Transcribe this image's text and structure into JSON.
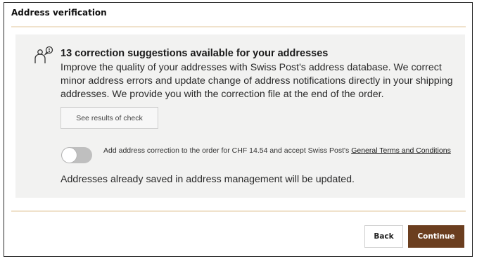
{
  "dialog": {
    "title": "Address verification"
  },
  "panel": {
    "icon": "address-correction-people-icon",
    "headline": "13 correction suggestions available for your addresses",
    "description": "Improve the quality of your addresses with Swiss Post's address database. We correct minor address errors and update change of address notifications directly in your shipping addresses. We provide you with the correction file at the end of the order.",
    "results_button_label": "See results of check",
    "toggle": {
      "state": "off",
      "label_prefix": "Add address correction to the order for CHF 14.54 and accept Swiss Post's ",
      "terms_link": "General Terms and Conditions"
    },
    "saved_note": "Addresses already saved in address management will be updated."
  },
  "footer": {
    "back_label": "Back",
    "continue_label": "Continue"
  },
  "colors": {
    "accent": "#6b3e1f",
    "divider": "#f0e2cc",
    "panel_bg": "#f2f2f1",
    "toggle_off": "#bfbfbf"
  }
}
